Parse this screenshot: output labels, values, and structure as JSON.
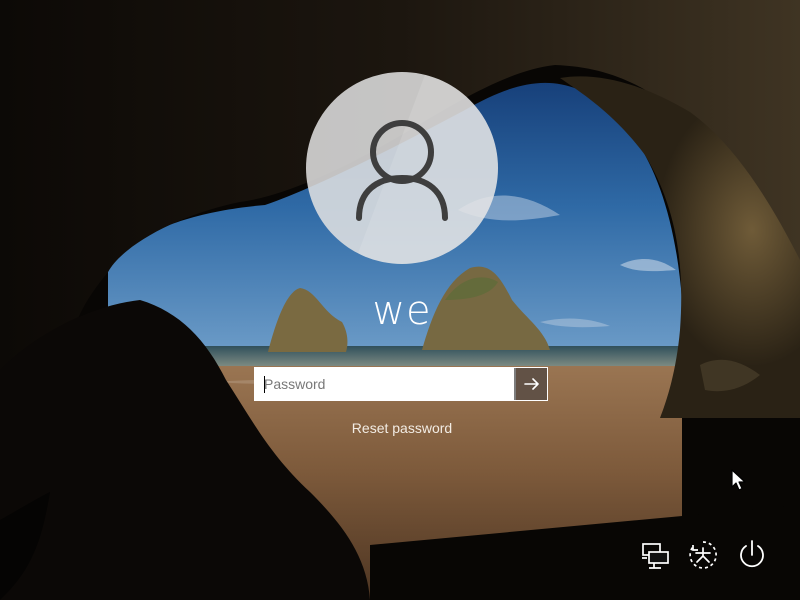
{
  "lock_screen": {
    "username": "we",
    "password": {
      "placeholder": "Password",
      "value": ""
    },
    "reset_password_label": "Reset password"
  },
  "icons": {
    "avatar": "user-silhouette-icon",
    "submit": "arrow-right-icon",
    "network": "network-icon",
    "ease_of_access": "ease-of-access-icon",
    "power": "power-icon",
    "cursor": "mouse-pointer-icon"
  },
  "colors": {
    "text": "#ffffff",
    "avatar_background": "#e2e2e2",
    "submit_button": "#463426",
    "link_text": "#f2ece4"
  }
}
